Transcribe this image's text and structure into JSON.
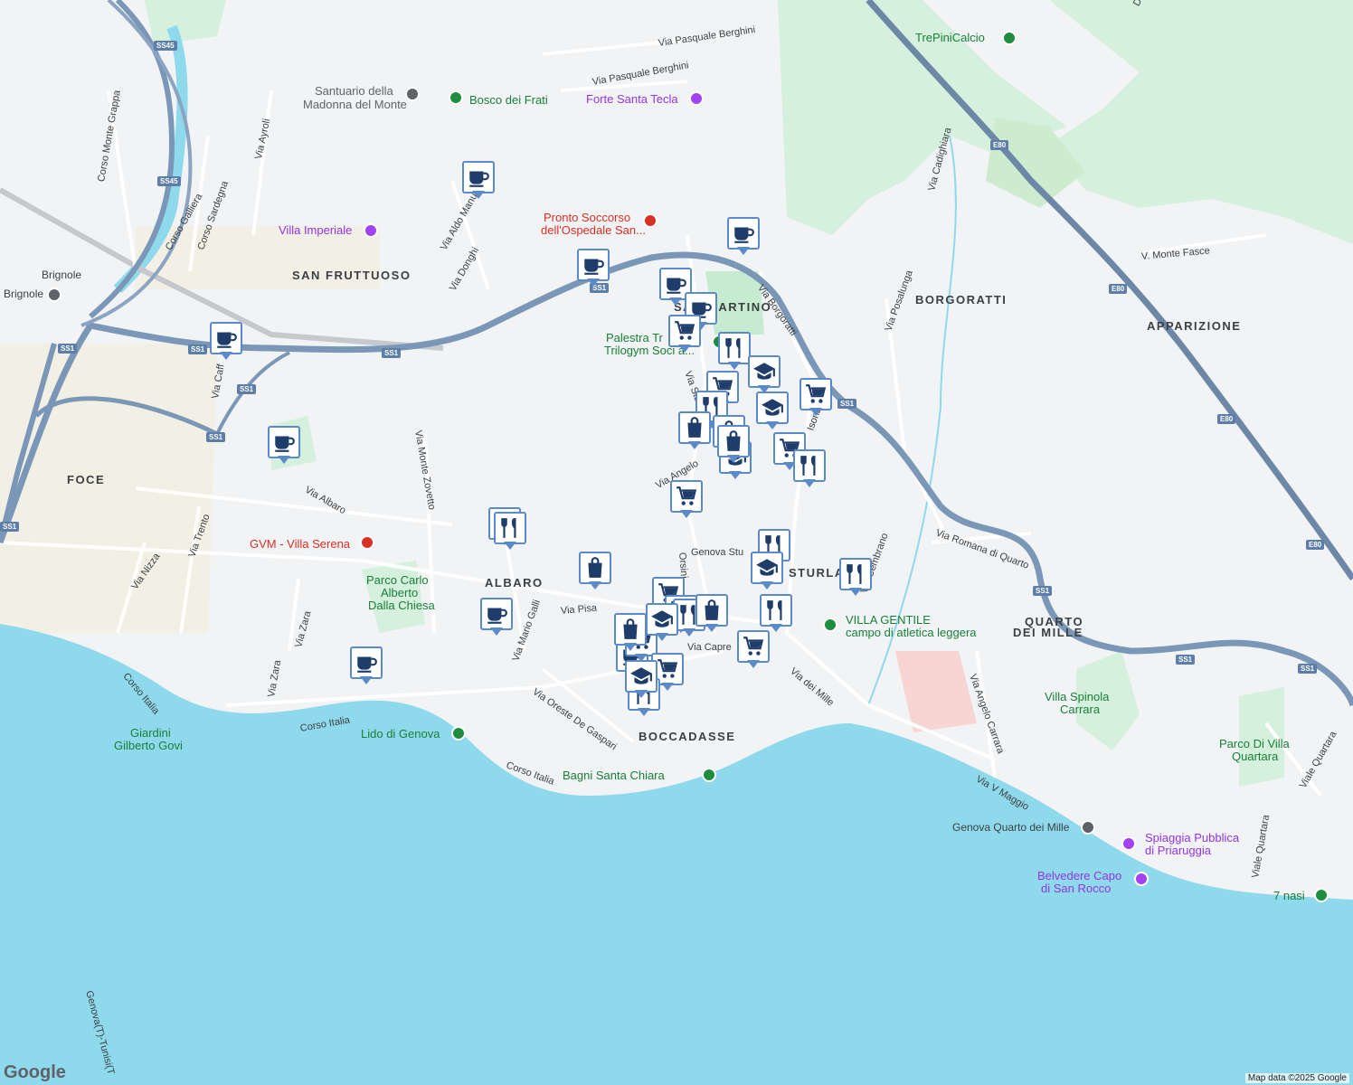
{
  "map": {
    "districts": [
      {
        "text": "SAN FRUTTUOSO"
      },
      {
        "text": "BORGORATTI"
      },
      {
        "text": "APPARIZIONE"
      },
      {
        "text": "FOCE"
      },
      {
        "text": "ALBARO"
      },
      {
        "text": "BOCCADASSE"
      },
      {
        "text": "QUARTO"
      },
      {
        "text": "DEI MILLE"
      },
      {
        "text": "SAN MARTINO"
      },
      {
        "text": "STURLA"
      }
    ],
    "streets": [
      "Via Pasquale Berghini",
      "Via Pasquale Berghini",
      "Corso Monte Grappa",
      "Corso Galliera",
      "Corso Sardegna",
      "Via Ayroli",
      "Via Aldo Manuzio",
      "Via Donghi",
      "Via Borgoratti",
      "Via Cadighiara",
      "V. Monte Fasce",
      "Via Posalunga",
      "Via Albaro",
      "Via Monte Zovetto",
      "Via Trento",
      "Via Nizza",
      "Via Zara",
      "Via Zara",
      "Corso Italia",
      "Corso Italia",
      "Corso Italia",
      "Via Pisa",
      "Via Mario Galli",
      "Via Oreste De Gaspari",
      "Via Angelo",
      "Via Stu",
      "Via Cembrano",
      "Via Romana di Quarto",
      "Via dei Mille",
      "Via Angelo Carrara",
      "Via V Maggio",
      "Viale Quartara",
      "Viale Quartara",
      "Via Capre",
      "Genova Stu",
      "Via Caff",
      "Orsini",
      "Genova(T)-Tunisi(T",
      "Isonzo",
      "Dalla parte del cavallo"
    ],
    "pois": [
      {
        "text": "TrePiniCalcio",
        "kind": "green"
      },
      {
        "text": "Santuario della",
        "kind": "gray"
      },
      {
        "text": "Madonna del Monte",
        "kind": "gray"
      },
      {
        "text": "Bosco dei Frati",
        "kind": "green"
      },
      {
        "text": "Forte Santa Tecla",
        "kind": "purple"
      },
      {
        "text": "Pronto Soccorso",
        "kind": "red"
      },
      {
        "text": "dell'Ospedale San...",
        "kind": "red"
      },
      {
        "text": "Villa Imperiale",
        "kind": "purple"
      },
      {
        "text": "Brignole",
        "kind": "dark"
      },
      {
        "text": "Brignole",
        "kind": "dark"
      },
      {
        "text": "Palestra Tr",
        "kind": "green"
      },
      {
        "text": "Trilogym Soci a...",
        "kind": "green"
      },
      {
        "text": "GVM - Villa Serena",
        "kind": "red"
      },
      {
        "text": "Parco Carlo",
        "kind": "green"
      },
      {
        "text": "Alberto",
        "kind": "green"
      },
      {
        "text": "Dalla Chiesa",
        "kind": "green"
      },
      {
        "text": "VILLA GENTILE",
        "kind": "green"
      },
      {
        "text": "campo di atletica leggera",
        "kind": "green"
      },
      {
        "text": "Villa Spinola",
        "kind": "green"
      },
      {
        "text": "Carrara",
        "kind": "green"
      },
      {
        "text": "Parco Di Villa",
        "kind": "green"
      },
      {
        "text": "Quartara",
        "kind": "green"
      },
      {
        "text": "Giardini",
        "kind": "green"
      },
      {
        "text": "Gilberto Govi",
        "kind": "green"
      },
      {
        "text": "Lido di Genova",
        "kind": "green"
      },
      {
        "text": "Bagni Santa Chiara",
        "kind": "green"
      },
      {
        "text": "Genova Quarto dei Mille",
        "kind": "dark"
      },
      {
        "text": "Spiaggia Pubblica",
        "kind": "purple"
      },
      {
        "text": "di Priaruggia",
        "kind": "purple"
      },
      {
        "text": "Belvedere Capo",
        "kind": "purple"
      },
      {
        "text": "di San Rocco",
        "kind": "purple"
      },
      {
        "text": "7 nasi",
        "kind": "green"
      }
    ],
    "shields": [
      "SS45",
      "SS45",
      "SS1",
      "SS1",
      "SS1",
      "SS1",
      "SS1",
      "SS1",
      "SS1",
      "SS1",
      "SS1",
      "SS1",
      "SS1",
      "E80",
      "E80",
      "E80",
      "E80"
    ],
    "markers": [
      "cafe",
      "cafe",
      "cafe",
      "cafe",
      "cafe",
      "cafe",
      "cafe",
      "cafe",
      "cafe",
      "cafe",
      "shopping-cart",
      "shopping-cart",
      "shopping-cart",
      "shopping-cart",
      "shopping-cart",
      "shopping-cart",
      "shopping-cart",
      "shopping-cart",
      "shopping-cart",
      "shopping-cart",
      "restaurant",
      "restaurant",
      "restaurant",
      "restaurant",
      "restaurant",
      "restaurant",
      "restaurant",
      "restaurant",
      "restaurant",
      "restaurant",
      "school",
      "school",
      "school",
      "school",
      "school",
      "school",
      "shopping-bag",
      "shopping-bag",
      "shopping-bag",
      "shopping-bag",
      "shopping-bag",
      "shopping-bag"
    ],
    "colors": {
      "water": "#8fd9ec",
      "land": "#f1f3f4",
      "park": "#d5f0dc",
      "highway": "#7a97b8",
      "road": "#ffffff",
      "marker_border": "#5b8ac9",
      "marker_icon": "#1e3d6b"
    },
    "credit": "Map data ©2025 Google",
    "logo": "Google"
  }
}
